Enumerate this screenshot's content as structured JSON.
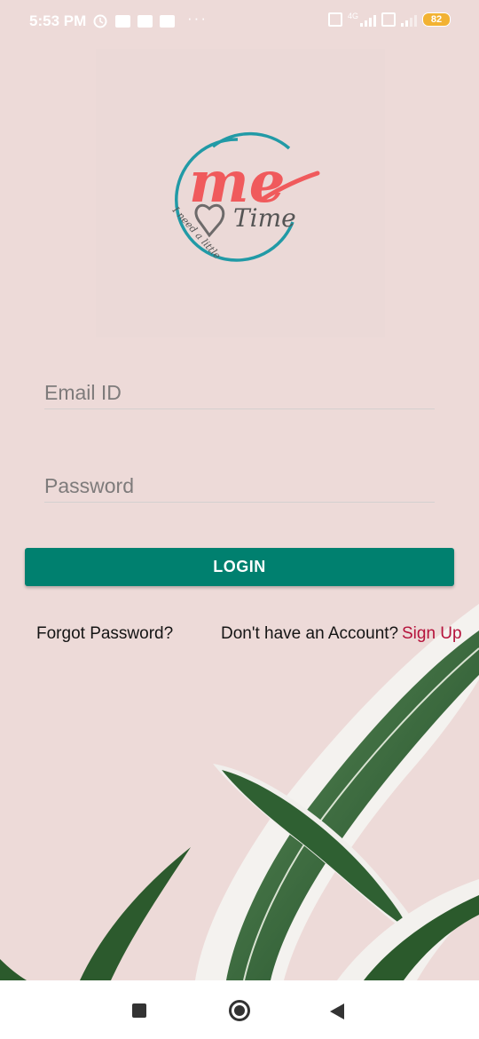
{
  "status_bar": {
    "time": "5:53 PM",
    "battery": "82",
    "network": "4G",
    "icons": [
      "alarm-icon",
      "message-icon",
      "message-icon",
      "message-icon",
      "more-dots-icon",
      "volte-icon",
      "signal-icon",
      "volte-icon",
      "signal-icon",
      "battery-icon"
    ]
  },
  "logo": {
    "script_text": "me",
    "time_text": "Time",
    "tagline": "I need a little",
    "colors": {
      "script": "#f05a5c",
      "ring": "#219aa6",
      "gray": "#6d6a6a"
    }
  },
  "form": {
    "email_placeholder": "Email ID",
    "email_value": "",
    "password_placeholder": "Password",
    "password_value": ""
  },
  "actions": {
    "login_label": "LOGIN",
    "forgot_label": "Forgot Password?",
    "no_account_label": "Don't have an Account?",
    "signup_label": "Sign Up"
  },
  "theme": {
    "background": "#eddad8",
    "accent": "#00806f",
    "link": "#b5123b"
  },
  "nav_bar": {
    "icons": [
      "recents-icon",
      "home-icon",
      "back-icon"
    ]
  }
}
